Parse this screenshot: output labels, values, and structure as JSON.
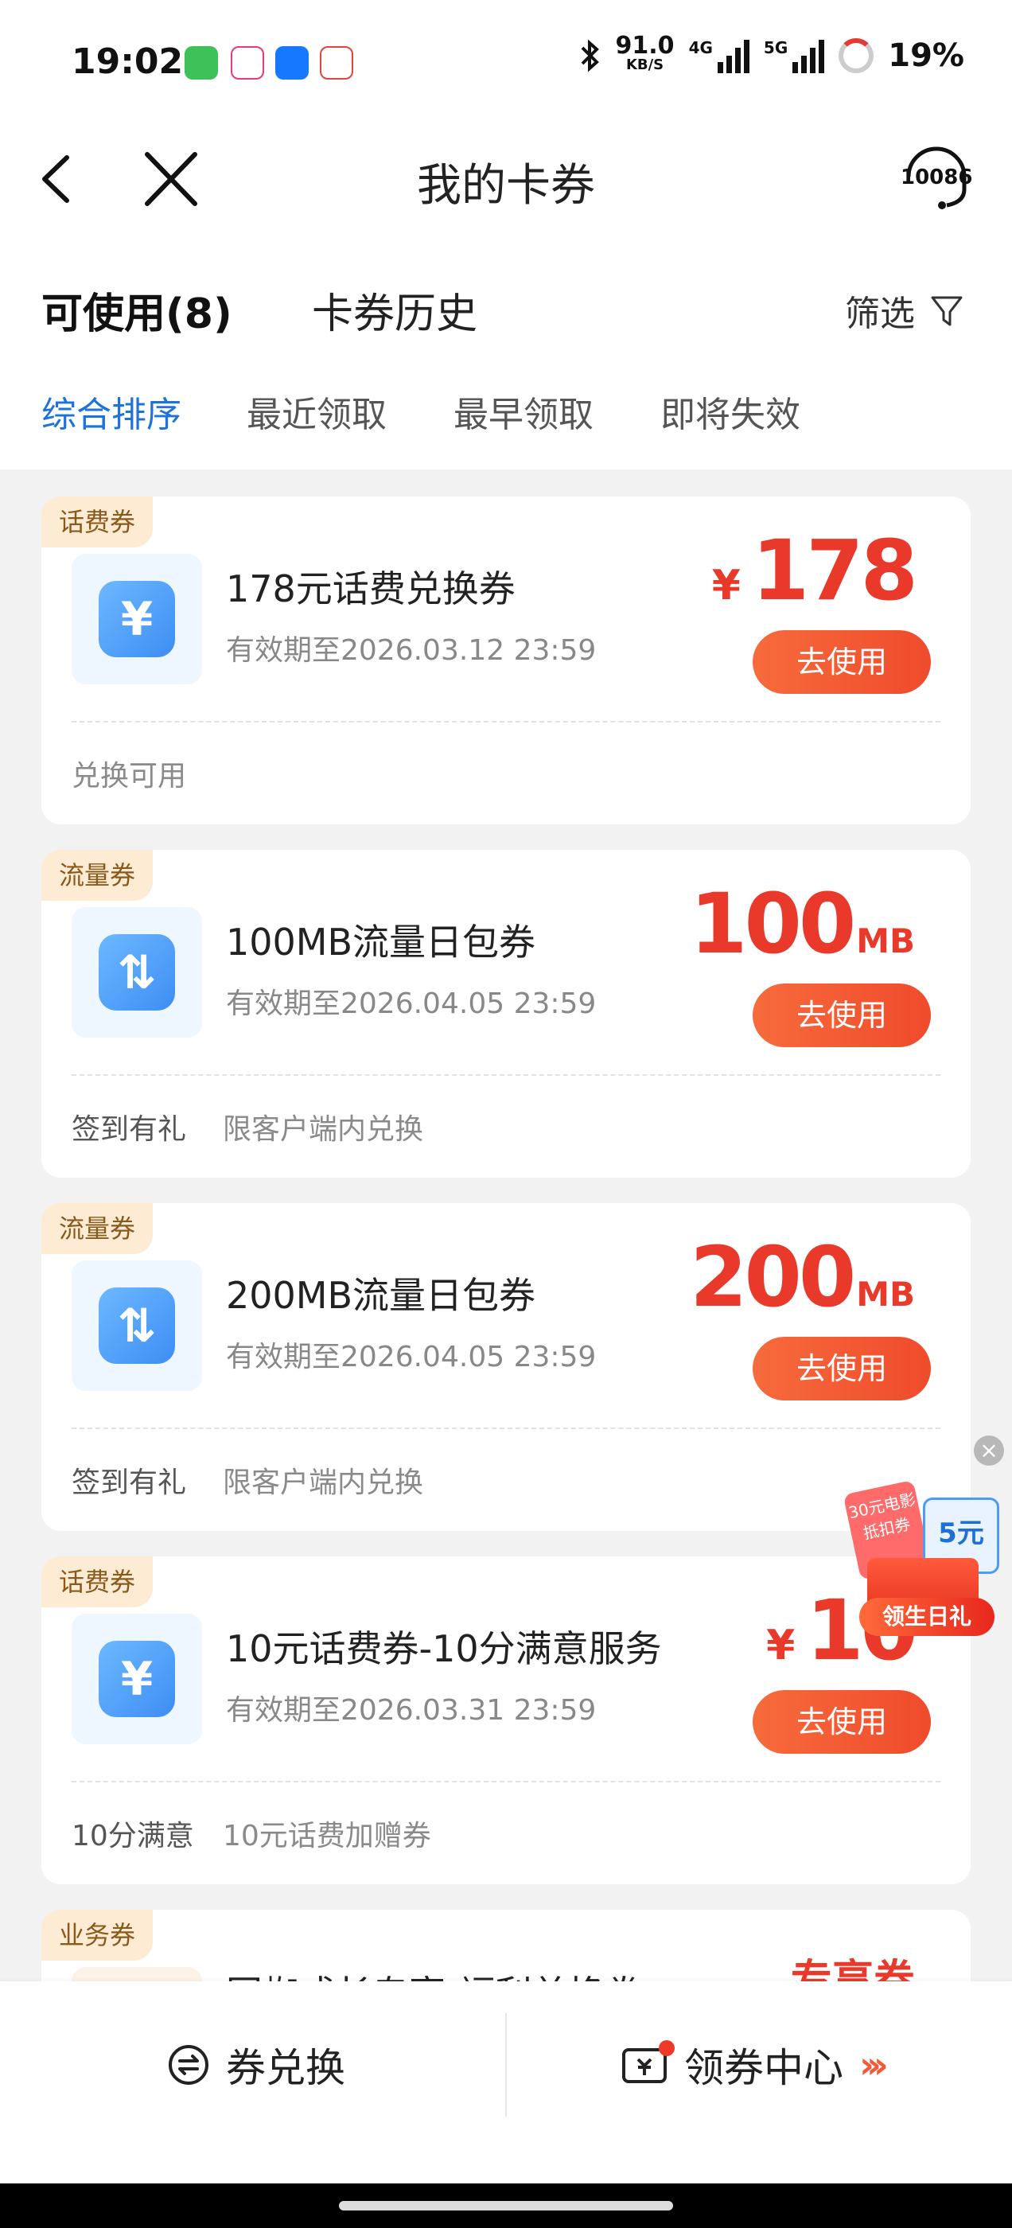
{
  "status_bar": {
    "time": "19:02",
    "net_speed_value": "91.0",
    "net_speed_unit": "KB/S",
    "sig1_label": "4G",
    "sig2_label": "5G",
    "battery": "19%",
    "notification_icons": [
      "messages-app-icon",
      "china-mobile-app-icon",
      "alipay-app-icon",
      "cloud-app-icon"
    ]
  },
  "header": {
    "title": "我的卡券",
    "service_number": "10086"
  },
  "tabs": {
    "available": "可使用(8)",
    "history": "卡券历史",
    "filter": "筛选"
  },
  "sort_tabs": [
    "综合排序",
    "最近领取",
    "最早领取",
    "即将失效"
  ],
  "coupons": [
    {
      "tag": "话费券",
      "icon": "yuan-icon",
      "icon_glyph": "¥",
      "name": "178元话费兑换券",
      "expiry": "有效期至2026.03.12 23:59",
      "currency": "¥",
      "amount": "178",
      "unit": "",
      "button": "去使用",
      "note1": "兑换可用",
      "note2": ""
    },
    {
      "tag": "流量券",
      "icon": "data-transfer-icon",
      "icon_glyph": "⇅",
      "name": "100MB流量日包券",
      "expiry": "有效期至2026.04.05 23:59",
      "currency": "",
      "amount": "100",
      "unit": "MB",
      "button": "去使用",
      "note1": "签到有礼",
      "note2": "限客户端内兑换"
    },
    {
      "tag": "流量券",
      "icon": "data-transfer-icon",
      "icon_glyph": "⇅",
      "name": "200MB流量日包券",
      "expiry": "有效期至2026.04.05 23:59",
      "currency": "",
      "amount": "200",
      "unit": "MB",
      "button": "去使用",
      "note1": "签到有礼",
      "note2": "限客户端内兑换"
    },
    {
      "tag": "话费券",
      "icon": "yuan-icon",
      "icon_glyph": "¥",
      "name": "10元话费券-10分满意服务",
      "expiry": "有效期至2026.03.31 23:59",
      "currency": "¥",
      "amount": "10",
      "unit": "",
      "button": "去使用",
      "note1": "10分满意",
      "note2": "10元话费加赠券"
    },
    {
      "tag": "业务券",
      "name": "国蜘成长专享-福利兑换券",
      "amount": "专享券"
    }
  ],
  "promo": {
    "ticket_text": "30元电影抵扣券",
    "voucher_text": "5元",
    "label": "领生日礼"
  },
  "bottom_bar": {
    "exchange": "券兑换",
    "center": "领券中心"
  }
}
